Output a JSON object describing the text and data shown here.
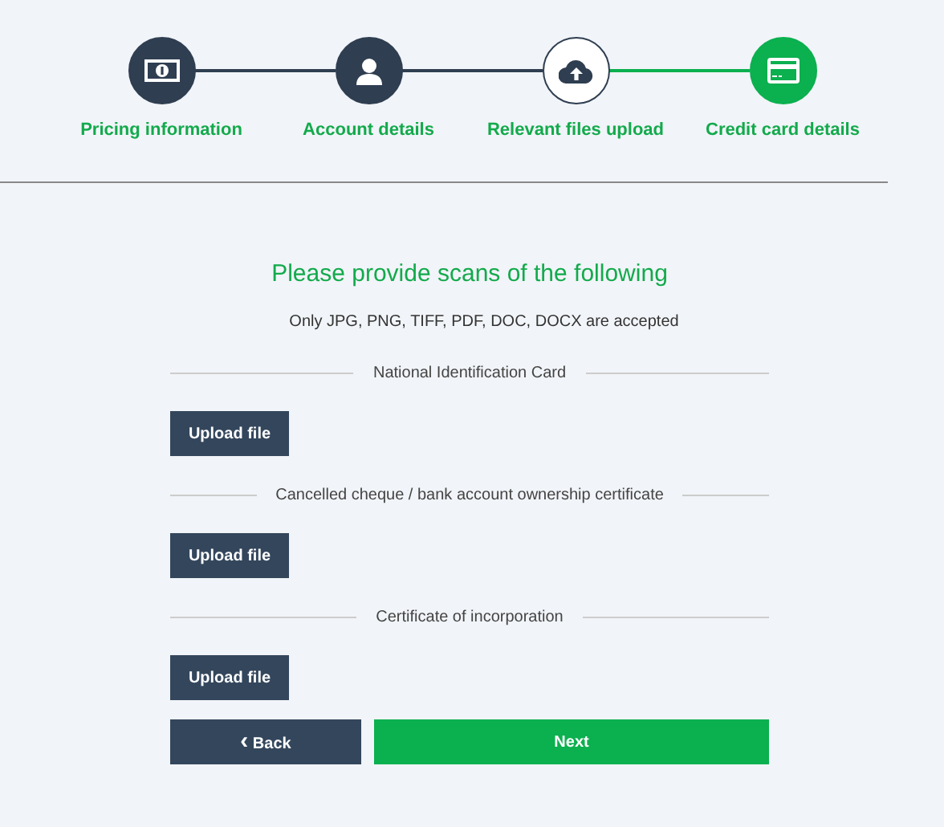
{
  "steps": [
    {
      "label": "Pricing information",
      "completed": true,
      "selected": false
    },
    {
      "label": "Account details",
      "completed": true,
      "selected": false
    },
    {
      "label": "Relevant files upload",
      "completed": false,
      "selected": true
    },
    {
      "label": "Credit card details",
      "completed": false,
      "selected": false
    }
  ],
  "heading": "Please provide scans of the following",
  "note": "Only JPG, PNG, TIFF, PDF, DOC, DOCX are accepted",
  "documents": [
    {
      "title": "National Identification Card",
      "button": "Upload file"
    },
    {
      "title": "Cancelled cheque / bank account ownership certificate",
      "button": "Upload file"
    },
    {
      "title": "Certificate of incorporation",
      "button": "Upload file"
    }
  ],
  "back_button": {
    "icon": "‹",
    "label": "Back"
  },
  "next_button": {
    "label": "Next"
  }
}
